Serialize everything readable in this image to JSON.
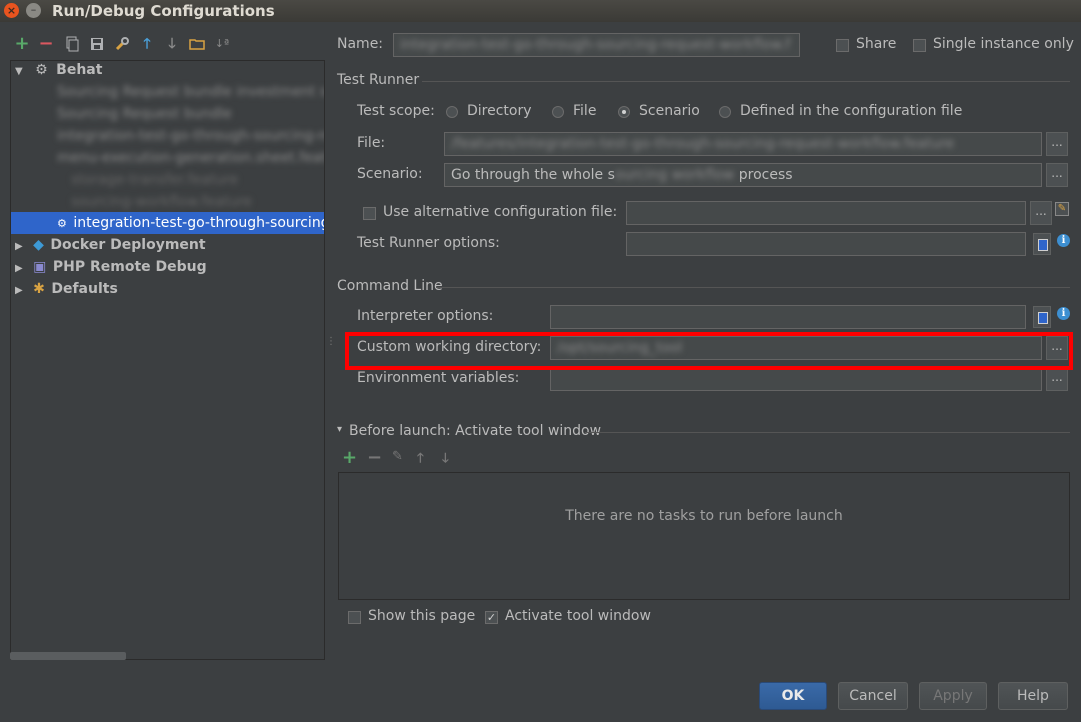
{
  "window": {
    "title": "Run/Debug Configurations"
  },
  "toolbar": {
    "icons": [
      "add-icon",
      "remove-icon",
      "copy-icon",
      "save-icon",
      "wrench-icon",
      "arrow-up-icon",
      "arrow-down-icon",
      "folder-icon",
      "sort-icon"
    ]
  },
  "tree": {
    "root": "Behat",
    "children_blurred": [
      "Sourcing Request bundle investment scenario",
      "Sourcing Request bundle",
      "integration-test-go-through-sourcing-request",
      "menu-execution-generation.sheet.feature",
      "storage-transfer.feature",
      "sourcing-workflow.feature"
    ],
    "selected": "integration-test-go-through-sourcing",
    "groups": [
      "Docker Deployment",
      "PHP Remote Debug",
      "Defaults"
    ]
  },
  "name_row": {
    "label": "Name:",
    "value_blurred": "integration-test-go-through-sourcing-request-workflow.f",
    "share": "Share",
    "single_instance": "Single instance only"
  },
  "test_runner": {
    "section": "Test Runner",
    "scope_label": "Test scope:",
    "scopes": [
      "Directory",
      "File",
      "Scenario",
      "Defined in the configuration file"
    ],
    "selected_scope": "Scenario",
    "file_label": "File:",
    "file_value_blurred": "/features/integration-test-go-through-sourcing-request-workflow.feature",
    "scenario_label": "Scenario:",
    "scenario_prefix": "Go through the whole s",
    "scenario_blur": "ourcing workflow",
    "scenario_suffix": "process",
    "alt_config_label": "Use alternative configuration file:",
    "runner_options_label": "Test Runner options:"
  },
  "command_line": {
    "section": "Command Line",
    "interpreter_label": "Interpreter options:",
    "cwd_label": "Custom working directory:",
    "cwd_value_blurred": "/opt/sourcing_tool",
    "env_label": "Environment variables:"
  },
  "before_launch": {
    "header": "Before launch: Activate tool window",
    "empty_text": "There are no tasks to run before launch",
    "show_page": "Show this page",
    "activate_tool": "Activate tool window"
  },
  "buttons": {
    "ok": "OK",
    "cancel": "Cancel",
    "apply": "Apply",
    "help": "Help"
  },
  "dots": "..."
}
